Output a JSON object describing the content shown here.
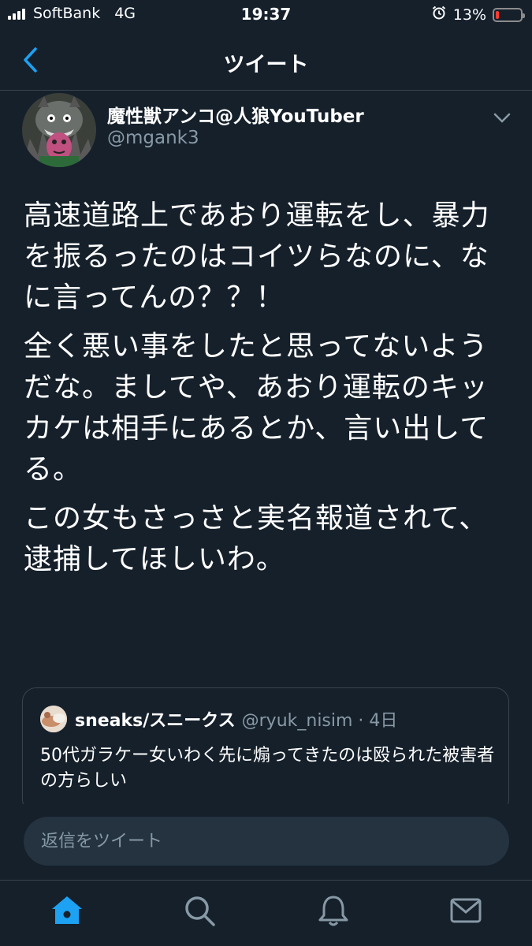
{
  "status_bar": {
    "carrier": "SoftBank",
    "network": "4G",
    "time": "19:37",
    "battery_percent": "13%",
    "battery_level": 0.13,
    "battery_color": "#ff3b30"
  },
  "nav": {
    "title": "ツイート",
    "back_icon": "chevron-left-icon"
  },
  "tweet": {
    "display_name": "魔性獣アンコ@人狼YouTuber",
    "handle": "@mgank3",
    "paragraphs": [
      "高速道路上であおり運転をし、暴力を振るったのはコイツらなのに、なに言ってんの？？！",
      "全く悪い事をしたと思ってないようだな。ましてや、あおり運転のキッカケは相手にあるとか、言い出してる。",
      "この女もさっさと実名報道されて、\n逮捕してほしいわ。"
    ]
  },
  "quoted_tweet": {
    "display_name": "sneaks/スニークス",
    "handle_time": "@ryuk_nisim · 4日",
    "text": "50代ガラケー女いわく先に煽ってきたのは殴られた被害者の方らしい"
  },
  "reply": {
    "placeholder": "返信をツイート"
  },
  "tabs": [
    {
      "name": "home",
      "icon": "home-icon",
      "active": true
    },
    {
      "name": "search",
      "icon": "search-icon",
      "active": false
    },
    {
      "name": "notifications",
      "icon": "bell-icon",
      "active": false
    },
    {
      "name": "messages",
      "icon": "mail-icon",
      "active": false
    }
  ],
  "colors": {
    "background": "#15202b",
    "accent": "#1da1f2",
    "secondary_text": "#8899a6",
    "border": "#38444d"
  }
}
